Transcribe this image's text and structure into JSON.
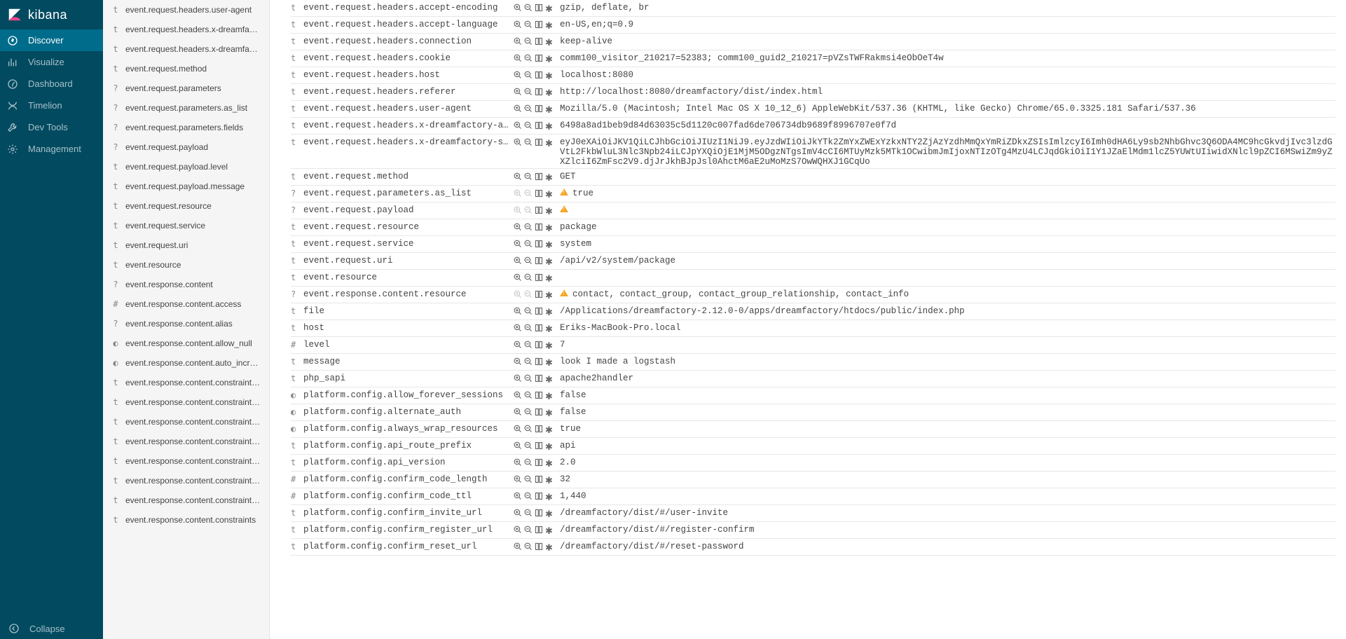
{
  "brand": "kibana",
  "nav": [
    {
      "icon": "discover",
      "label": "Discover",
      "active": true
    },
    {
      "icon": "visualize",
      "label": "Visualize",
      "active": false
    },
    {
      "icon": "dashboard",
      "label": "Dashboard",
      "active": false
    },
    {
      "icon": "timelion",
      "label": "Timelion",
      "active": false
    },
    {
      "icon": "devtools",
      "label": "Dev Tools",
      "active": false
    },
    {
      "icon": "management",
      "label": "Management",
      "active": false
    }
  ],
  "collapse_label": "Collapse",
  "fields": [
    {
      "type": "t",
      "name": "event.request.headers.user-agent"
    },
    {
      "type": "t",
      "name": "event.request.headers.x-dreamfact..."
    },
    {
      "type": "t",
      "name": "event.request.headers.x-dreamfact..."
    },
    {
      "type": "t",
      "name": "event.request.method"
    },
    {
      "type": "?",
      "name": "event.request.parameters"
    },
    {
      "type": "?",
      "name": "event.request.parameters.as_list"
    },
    {
      "type": "?",
      "name": "event.request.parameters.fields"
    },
    {
      "type": "?",
      "name": "event.request.payload"
    },
    {
      "type": "t",
      "name": "event.request.payload.level"
    },
    {
      "type": "t",
      "name": "event.request.payload.message"
    },
    {
      "type": "t",
      "name": "event.request.resource"
    },
    {
      "type": "t",
      "name": "event.request.service"
    },
    {
      "type": "t",
      "name": "event.request.uri"
    },
    {
      "type": "t",
      "name": "event.resource"
    },
    {
      "type": "?",
      "name": "event.response.content"
    },
    {
      "type": "#",
      "name": "event.response.content.access"
    },
    {
      "type": "?",
      "name": "event.response.content.alias"
    },
    {
      "type": "◐",
      "name": "event.response.content.allow_null"
    },
    {
      "type": "◐",
      "name": "event.response.content.auto_incre..."
    },
    {
      "type": "t",
      "name": "event.response.content.constraints...."
    },
    {
      "type": "t",
      "name": "event.response.content.constraints...."
    },
    {
      "type": "t",
      "name": "event.response.content.constraints...."
    },
    {
      "type": "t",
      "name": "event.response.content.constraints...."
    },
    {
      "type": "t",
      "name": "event.response.content.constraints...."
    },
    {
      "type": "t",
      "name": "event.response.content.constraints...."
    },
    {
      "type": "t",
      "name": "event.response.content.constraints...."
    },
    {
      "type": "t",
      "name": "event.response.content.constraints"
    }
  ],
  "rows": [
    {
      "type": "t",
      "name": "event.request.headers.accept-encoding",
      "value": "gzip, deflate, br"
    },
    {
      "type": "t",
      "name": "event.request.headers.accept-language",
      "value": "en-US,en;q=0.9"
    },
    {
      "type": "t",
      "name": "event.request.headers.connection",
      "value": "keep-alive"
    },
    {
      "type": "t",
      "name": "event.request.headers.cookie",
      "value": "comm100_visitor_210217=52383; comm100_guid2_210217=pVZsTWFRakmsi4eObOeT4w"
    },
    {
      "type": "t",
      "name": "event.request.headers.host",
      "value": "localhost:8080"
    },
    {
      "type": "t",
      "name": "event.request.headers.referer",
      "value": "http://localhost:8080/dreamfactory/dist/index.html"
    },
    {
      "type": "t",
      "name": "event.request.headers.user-agent",
      "value": "Mozilla/5.0 (Macintosh; Intel Mac OS X 10_12_6) AppleWebKit/537.36 (KHTML, like Gecko) Chrome/65.0.3325.181 Safari/537.36"
    },
    {
      "type": "t",
      "name": "event.request.headers.x-dreamfactory-api-key",
      "value": "6498a8ad1beb9d84d63035c5d1120c007fad6de706734db9689f8996707e0f7d"
    },
    {
      "type": "t",
      "name": "event.request.headers.x-dreamfactory-session-token",
      "value": "eyJ0eXAiOiJKV1QiLCJhbGciOiJIUzI1NiJ9.eyJzdWIiOiJkYTk2ZmYxZWExYzkxNTY2ZjAzYzdhMmQxYmRiZDkxZSIsImlzcyI6Imh0dHA6Ly9sb2NhbGhvc3Q6ODA4MC9hcGkvdjIvc3lzdGVtL2FkbWluL3Nlc3Npb24iLCJpYXQiOjE1MjM5ODgzNTgsImV4cCI6MTUyMzk5MTk1OCwibmJmIjoxNTIzOTg4MzU4LCJqdGkiOiI1Y1JZaElMdm1lcZ5YUWtUIiwidXNlcl9pZCI6MSwiZm9yZXZlciI6ZmFsc2V9.djJrJkhBJpJsl0AhctM6aE2uMoMzS7OwWQHXJ1GCqUo"
    },
    {
      "type": "t",
      "name": "event.request.method",
      "value": "GET"
    },
    {
      "type": "?",
      "name": "event.request.parameters.as_list",
      "value": "true",
      "warn": true,
      "noFilter": true
    },
    {
      "type": "?",
      "name": "event.request.payload",
      "value": "",
      "warn": true,
      "noFilter": true
    },
    {
      "type": "t",
      "name": "event.request.resource",
      "value": "package"
    },
    {
      "type": "t",
      "name": "event.request.service",
      "value": "system"
    },
    {
      "type": "t",
      "name": "event.request.uri",
      "value": "/api/v2/system/package"
    },
    {
      "type": "t",
      "name": "event.resource",
      "value": ""
    },
    {
      "type": "?",
      "name": "event.response.content.resource",
      "value": "contact, contact_group, contact_group_relationship, contact_info",
      "warn": true,
      "noFilter": true
    },
    {
      "type": "t",
      "name": "file",
      "value": "/Applications/dreamfactory-2.12.0-0/apps/dreamfactory/htdocs/public/index.php"
    },
    {
      "type": "t",
      "name": "host",
      "value": "Eriks-MacBook-Pro.local"
    },
    {
      "type": "#",
      "name": "level",
      "value": "7"
    },
    {
      "type": "t",
      "name": "message",
      "value": "look I made a logstash"
    },
    {
      "type": "t",
      "name": "php_sapi",
      "value": "apache2handler"
    },
    {
      "type": "◐",
      "name": "platform.config.allow_forever_sessions",
      "value": "false"
    },
    {
      "type": "◐",
      "name": "platform.config.alternate_auth",
      "value": "false"
    },
    {
      "type": "◐",
      "name": "platform.config.always_wrap_resources",
      "value": "true"
    },
    {
      "type": "t",
      "name": "platform.config.api_route_prefix",
      "value": "api"
    },
    {
      "type": "t",
      "name": "platform.config.api_version",
      "value": "2.0"
    },
    {
      "type": "#",
      "name": "platform.config.confirm_code_length",
      "value": "32"
    },
    {
      "type": "#",
      "name": "platform.config.confirm_code_ttl",
      "value": "1,440"
    },
    {
      "type": "t",
      "name": "platform.config.confirm_invite_url",
      "value": "/dreamfactory/dist/#/user-invite"
    },
    {
      "type": "t",
      "name": "platform.config.confirm_register_url",
      "value": "/dreamfactory/dist/#/register-confirm"
    },
    {
      "type": "t",
      "name": "platform.config.confirm_reset_url",
      "value": "/dreamfactory/dist/#/reset-password"
    }
  ]
}
